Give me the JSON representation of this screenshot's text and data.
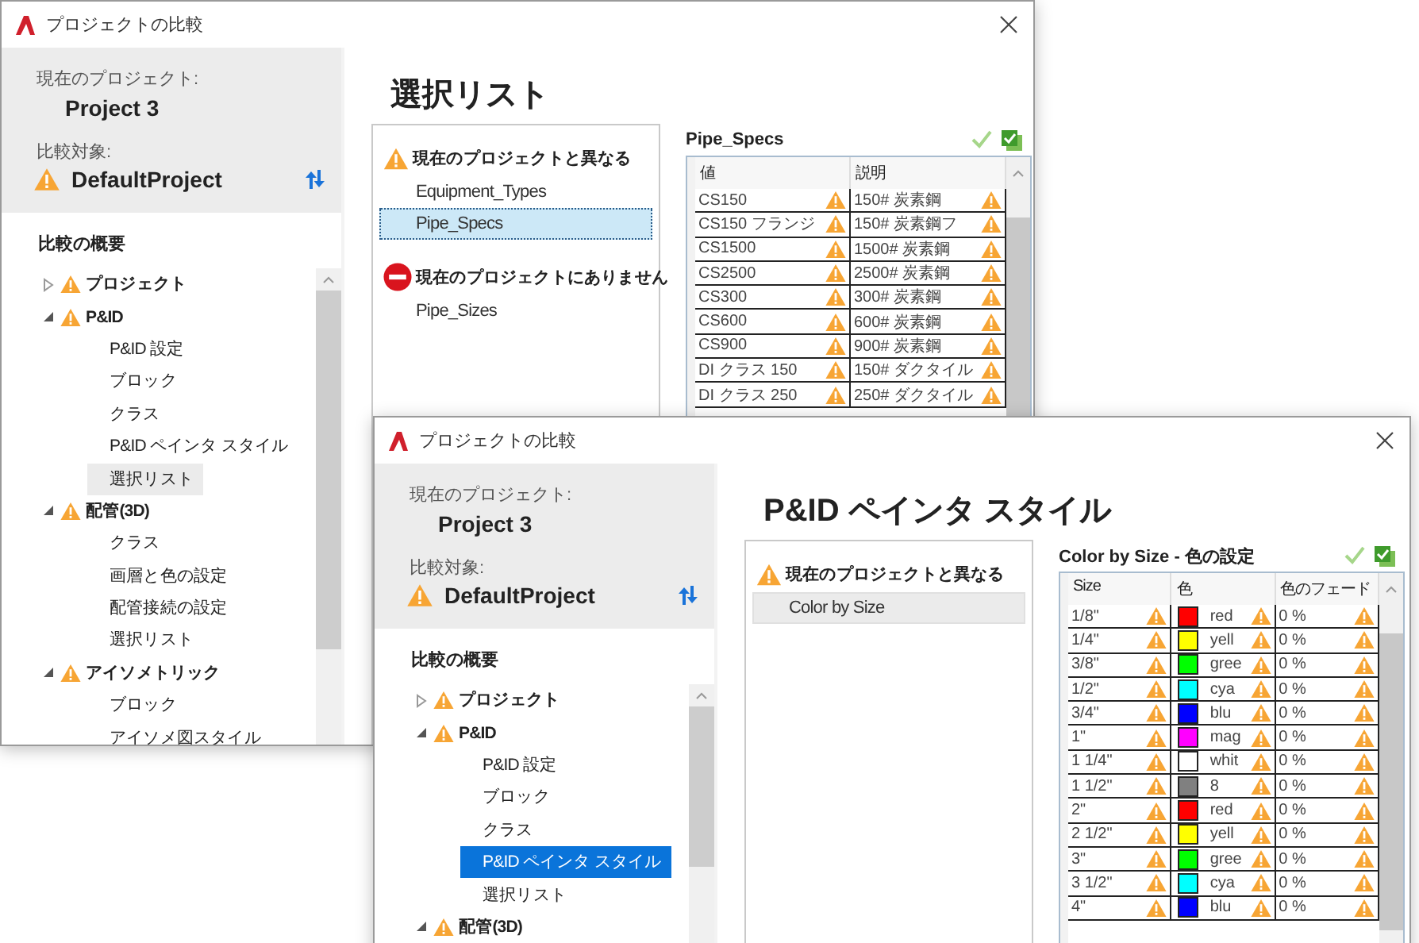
{
  "windows": [
    {
      "active": false,
      "title": "プロジェクトの比較",
      "current_project_label": "現在のプロジェクト:",
      "current_project": "Project 3",
      "compare_label": "比較対象:",
      "compare_project": "DefaultProject",
      "summary_title": "比較の概要",
      "tree": [
        {
          "label": "プロジェクト",
          "expanded": false
        },
        {
          "label": "P&ID",
          "expanded": true,
          "children": [
            {
              "label": "P&ID 設定",
              "selected": false
            },
            {
              "label": "ブロック",
              "selected": false
            },
            {
              "label": "クラス",
              "selected": false
            },
            {
              "label": "P&ID ペインタ スタイル",
              "selected": false
            },
            {
              "label": "選択リスト",
              "selected": true
            }
          ]
        },
        {
          "label": "配管(3D)",
          "expanded": true,
          "children": [
            {
              "label": "クラス",
              "selected": false
            },
            {
              "label": "画層と色の設定",
              "selected": false
            },
            {
              "label": "配管接続の設定",
              "selected": false
            },
            {
              "label": "選択リスト",
              "selected": false
            }
          ]
        },
        {
          "label": "アイソメトリック",
          "expanded": true,
          "children": [
            {
              "label": "ブロック",
              "selected": false
            },
            {
              "label": "アイソメ図スタイル",
              "selected": false
            }
          ]
        }
      ],
      "heading": "選択リスト",
      "groups": [
        {
          "kind": "differs",
          "label": "現在のプロジェクトと異なる",
          "items": [
            {
              "label": "Equipment_Types",
              "selected": false
            },
            {
              "label": "Pipe_Specs",
              "selected": true
            }
          ]
        },
        {
          "kind": "missing",
          "label": "現在のプロジェクトにありません",
          "items": [
            {
              "label": "Pipe_Sizes",
              "selected": false
            }
          ]
        }
      ],
      "table": {
        "title": "Pipe_Specs",
        "columns": [
          "値",
          "説明"
        ],
        "rows": [
          [
            {
              "text": "CS150"
            },
            {
              "text": "150# 炭素鋼"
            }
          ],
          [
            {
              "text": "CS150 フランジ"
            },
            {
              "text": "150# 炭素鋼フ"
            }
          ],
          [
            {
              "text": "CS1500"
            },
            {
              "text": "1500# 炭素鋼"
            }
          ],
          [
            {
              "text": "CS2500"
            },
            {
              "text": "2500# 炭素鋼"
            }
          ],
          [
            {
              "text": "CS300"
            },
            {
              "text": "300# 炭素鋼"
            }
          ],
          [
            {
              "text": "CS600"
            },
            {
              "text": "600# 炭素鋼"
            }
          ],
          [
            {
              "text": "CS900"
            },
            {
              "text": "900# 炭素鋼"
            }
          ],
          [
            {
              "text": "DI クラス 150"
            },
            {
              "text": "150# ダクタイル"
            }
          ],
          [
            {
              "text": "DI クラス 250"
            },
            {
              "text": "250# ダクタイル"
            }
          ]
        ]
      }
    },
    {
      "active": true,
      "title": "プロジェクトの比較",
      "current_project_label": "現在のプロジェクト:",
      "current_project": "Project 3",
      "compare_label": "比較対象:",
      "compare_project": "DefaultProject",
      "summary_title": "比較の概要",
      "tree": [
        {
          "label": "プロジェクト",
          "expanded": false
        },
        {
          "label": "P&ID",
          "expanded": true,
          "children": [
            {
              "label": "P&ID 設定",
              "selected": false
            },
            {
              "label": "ブロック",
              "selected": false
            },
            {
              "label": "クラス",
              "selected": false
            },
            {
              "label": "P&ID ペインタ スタイル",
              "selected": true
            },
            {
              "label": "選択リスト",
              "selected": false
            }
          ]
        },
        {
          "label": "配管(3D)",
          "expanded": true
        }
      ],
      "heading": "P&ID ペインタ スタイル",
      "groups": [
        {
          "kind": "differs",
          "label": "現在のプロジェクトと異なる",
          "items": [
            {
              "label": "Color by Size",
              "selected": true
            }
          ]
        }
      ],
      "table": {
        "title": "Color by Size  - 色の設定",
        "columns": [
          "Size",
          "色",
          "色のフェード"
        ],
        "rows": [
          [
            {
              "text": "1/8\""
            },
            {
              "text": "red",
              "color": "#ff0000"
            },
            {
              "text": "0 %"
            }
          ],
          [
            {
              "text": "1/4\""
            },
            {
              "text": "yell",
              "color": "#ffff00"
            },
            {
              "text": "0 %"
            }
          ],
          [
            {
              "text": "3/8\""
            },
            {
              "text": "gree",
              "color": "#00ff00"
            },
            {
              "text": "0 %"
            }
          ],
          [
            {
              "text": "1/2\""
            },
            {
              "text": "cya",
              "color": "#00ffff"
            },
            {
              "text": "0 %"
            }
          ],
          [
            {
              "text": "3/4\""
            },
            {
              "text": "blu",
              "color": "#0000ff"
            },
            {
              "text": "0 %"
            }
          ],
          [
            {
              "text": "1\""
            },
            {
              "text": "mag",
              "color": "#ff00ff"
            },
            {
              "text": "0 %"
            }
          ],
          [
            {
              "text": "1 1/4\""
            },
            {
              "text": "whit",
              "color": "#ffffff"
            },
            {
              "text": "0 %"
            }
          ],
          [
            {
              "text": "1 1/2\""
            },
            {
              "text": "8",
              "color": "#808080"
            },
            {
              "text": "0 %"
            }
          ],
          [
            {
              "text": "2\""
            },
            {
              "text": "red",
              "color": "#ff0000"
            },
            {
              "text": "0 %"
            }
          ],
          [
            {
              "text": "2 1/2\""
            },
            {
              "text": "yell",
              "color": "#ffff00"
            },
            {
              "text": "0 %"
            }
          ],
          [
            {
              "text": "3\""
            },
            {
              "text": "gree",
              "color": "#00ff00"
            },
            {
              "text": "0 %"
            }
          ],
          [
            {
              "text": "3 1/2\""
            },
            {
              "text": "cya",
              "color": "#00ffff"
            },
            {
              "text": "0 %"
            }
          ],
          [
            {
              "text": "4\""
            },
            {
              "text": "blu",
              "color": "#0000ff"
            },
            {
              "text": "0 %"
            }
          ]
        ]
      }
    }
  ]
}
